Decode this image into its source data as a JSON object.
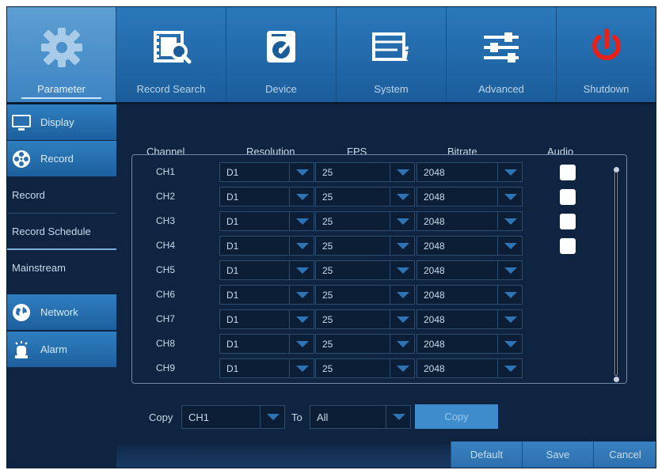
{
  "topnav": [
    {
      "label": "Parameter",
      "icon": "gear-icon",
      "active": true
    },
    {
      "label": "Record Search",
      "icon": "film-search-icon"
    },
    {
      "label": "Device",
      "icon": "disk-icon"
    },
    {
      "label": "System",
      "icon": "system-info-icon"
    },
    {
      "label": "Advanced",
      "icon": "sliders-icon"
    },
    {
      "label": "Shutdown",
      "icon": "power-icon"
    }
  ],
  "sidebar": {
    "display": "Display",
    "record": "Record",
    "sub_record": "Record",
    "sub_record_schedule": "Record Schedule",
    "sub_mainstream": "Mainstream",
    "network": "Network",
    "alarm": "Alarm"
  },
  "table": {
    "headers": {
      "channel": "Channel",
      "resolution": "Resolution",
      "fps": "FPS",
      "bitrate": "Bitrate",
      "audio": "Audio"
    },
    "rows": [
      {
        "channel": "CH1",
        "resolution": "D1",
        "fps": "25",
        "bitrate": "2048",
        "audio": false
      },
      {
        "channel": "CH2",
        "resolution": "D1",
        "fps": "25",
        "bitrate": "2048",
        "audio": false
      },
      {
        "channel": "CH3",
        "resolution": "D1",
        "fps": "25",
        "bitrate": "2048",
        "audio": false
      },
      {
        "channel": "CH4",
        "resolution": "D1",
        "fps": "25",
        "bitrate": "2048",
        "audio": false
      },
      {
        "channel": "CH5",
        "resolution": "D1",
        "fps": "25",
        "bitrate": "2048"
      },
      {
        "channel": "CH6",
        "resolution": "D1",
        "fps": "25",
        "bitrate": "2048"
      },
      {
        "channel": "CH7",
        "resolution": "D1",
        "fps": "25",
        "bitrate": "2048"
      },
      {
        "channel": "CH8",
        "resolution": "D1",
        "fps": "25",
        "bitrate": "2048"
      },
      {
        "channel": "CH9",
        "resolution": "D1",
        "fps": "25",
        "bitrate": "2048"
      }
    ]
  },
  "copy": {
    "label": "Copy",
    "from_value": "CH1",
    "to_label": "To",
    "to_value": "All",
    "button": "Copy"
  },
  "buttons": {
    "default": "Default",
    "save": "Save",
    "cancel": "Cancel"
  },
  "colors": {
    "accent": "#2a78bb",
    "background": "#0f2440",
    "power": "#e8201a"
  }
}
